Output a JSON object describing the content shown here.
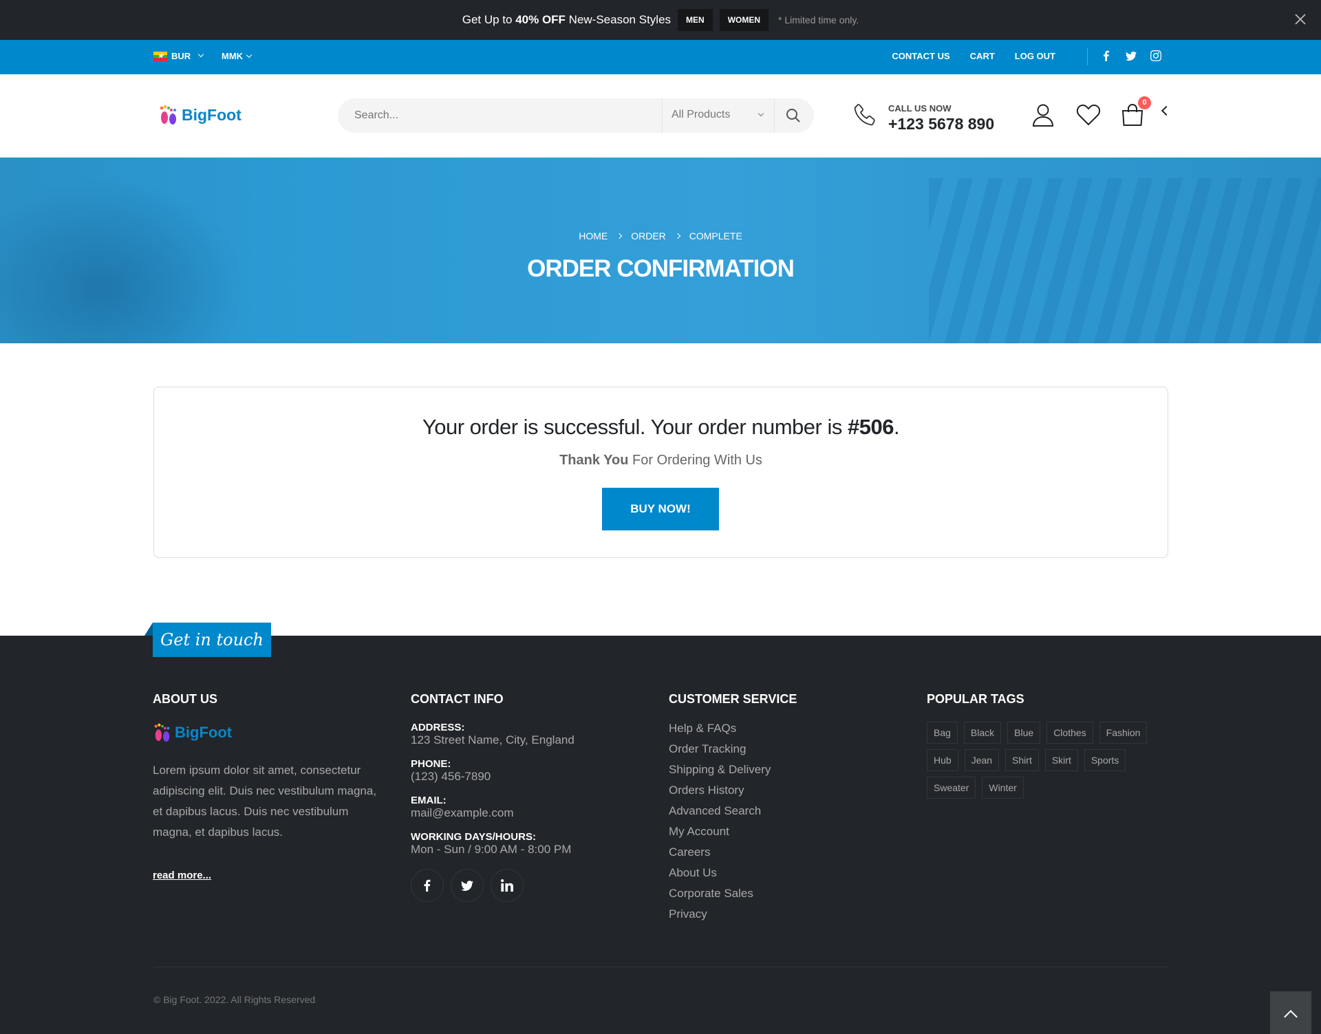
{
  "promo": {
    "text_pre": "Get Up to ",
    "text_bold": "40% OFF",
    "text_post": " New-Season Styles",
    "btn_men": "MEN",
    "btn_women": "WOMEN",
    "limited": "* Limited time only."
  },
  "topbar": {
    "language": "BUR",
    "currency": "MMK",
    "links": [
      "CONTACT US",
      "CART",
      "LOG OUT"
    ],
    "social_icons": [
      "facebook-icon",
      "twitter-icon",
      "instagram-icon"
    ]
  },
  "header": {
    "logo_text": "BigFoot",
    "search_placeholder": "Search...",
    "search_category": "All Products",
    "call_label": "CALL US NOW",
    "call_number": "+123 5678 890",
    "cart_count": "0"
  },
  "banner": {
    "breadcrumbs": [
      "HOME",
      "ORDER",
      "COMPLETE"
    ],
    "title": "ORDER CONFIRMATION"
  },
  "confirmation": {
    "message_pre": "Your order is successful. Your order number is ",
    "order_number": "#506",
    "message_post": ".",
    "thanks_bold": "Thank You",
    "thanks_rest": " For Ordering With Us",
    "button": "BUY NOW!"
  },
  "footer": {
    "get_in_touch": "Get in touch",
    "about": {
      "title": "ABOUT US",
      "logo_text": "BigFoot",
      "text": "Lorem ipsum dolor sit amet, consectetur adipiscing elit. Duis nec vestibulum magna, et dapibus lacus. Duis nec vestibulum magna, et dapibus lacus.",
      "read_more": "read more..."
    },
    "contact": {
      "title": "CONTACT INFO",
      "address_label": "ADDRESS:",
      "address": "123 Street Name, City, England",
      "phone_label": "PHONE:",
      "phone": "(123) 456-7890",
      "email_label": "EMAIL:",
      "email": "mail@example.com",
      "hours_label": "WORKING DAYS/HOURS:",
      "hours": "Mon - Sun / 9:00 AM - 8:00 PM"
    },
    "service": {
      "title": "CUSTOMER SERVICE",
      "links": [
        "Help & FAQs",
        "Order Tracking",
        "Shipping & Delivery",
        "Orders History",
        "Advanced Search",
        "My Account",
        "Careers",
        "About Us",
        "Corporate Sales",
        "Privacy"
      ]
    },
    "tags": {
      "title": "POPULAR TAGS",
      "items": [
        "Bag",
        "Black",
        "Blue",
        "Clothes",
        "Fashion",
        "Hub",
        "Jean",
        "Shirt",
        "Skirt",
        "Sports",
        "Sweater",
        "Winter"
      ]
    },
    "copyright": "© Big Foot. 2022. All Rights Reserved"
  },
  "colors": {
    "primary": "#0088cc",
    "dark": "#222529",
    "badge": "#ff5b5b"
  }
}
